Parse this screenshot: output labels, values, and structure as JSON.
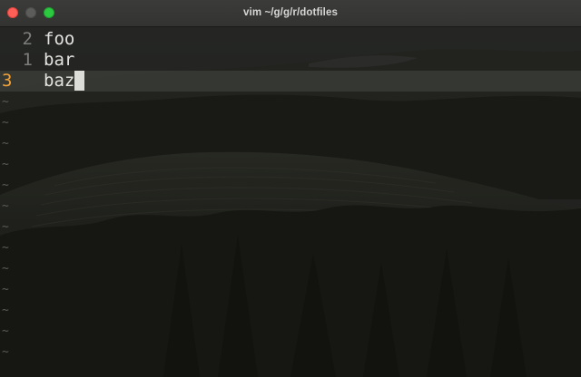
{
  "window": {
    "title": "vim ~/g/g/r/dotfiles"
  },
  "editor": {
    "lines": [
      {
        "number": "2",
        "text": "foo",
        "current": false
      },
      {
        "number": "1",
        "text": "bar",
        "current": false
      },
      {
        "number": "3",
        "text": "baz",
        "current": true
      }
    ],
    "empty_line_marker": "~"
  },
  "colors": {
    "current_line_number": "#f0a23a",
    "line_number": "#7d7e7b",
    "text": "#e3e3e0",
    "cursor": "#dcdcd8"
  }
}
